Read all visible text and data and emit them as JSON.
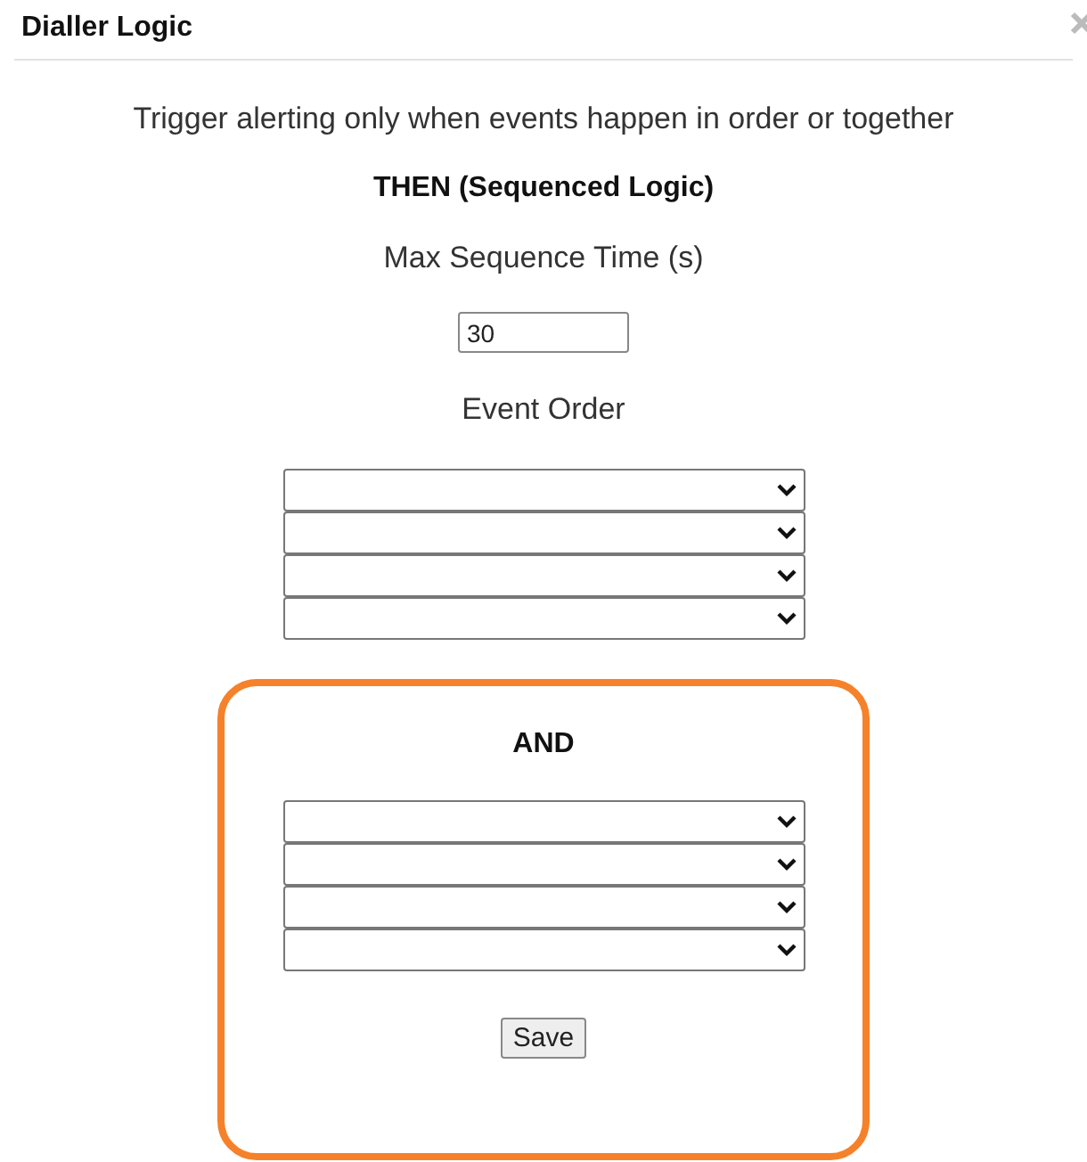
{
  "dialog": {
    "title": "Dialler Logic"
  },
  "description": "Trigger alerting only when events happen in order or together",
  "sequence": {
    "heading": "THEN (Sequenced Logic)",
    "max_time_label": "Max Sequence Time (s)",
    "max_time_value": "30",
    "order_label": "Event Order",
    "dropdowns": [
      {
        "kind": "dropdown"
      },
      {
        "kind": "dropdown"
      },
      {
        "kind": "dropdown"
      },
      {
        "kind": "dropdown"
      }
    ]
  },
  "and_group": {
    "heading": "AND",
    "highlighted": true,
    "dropdowns": [
      {
        "kind": "dropdown"
      },
      {
        "kind": "dropdown"
      },
      {
        "kind": "dropdown"
      },
      {
        "kind": "dropdown"
      }
    ],
    "save_button": "Save"
  }
}
